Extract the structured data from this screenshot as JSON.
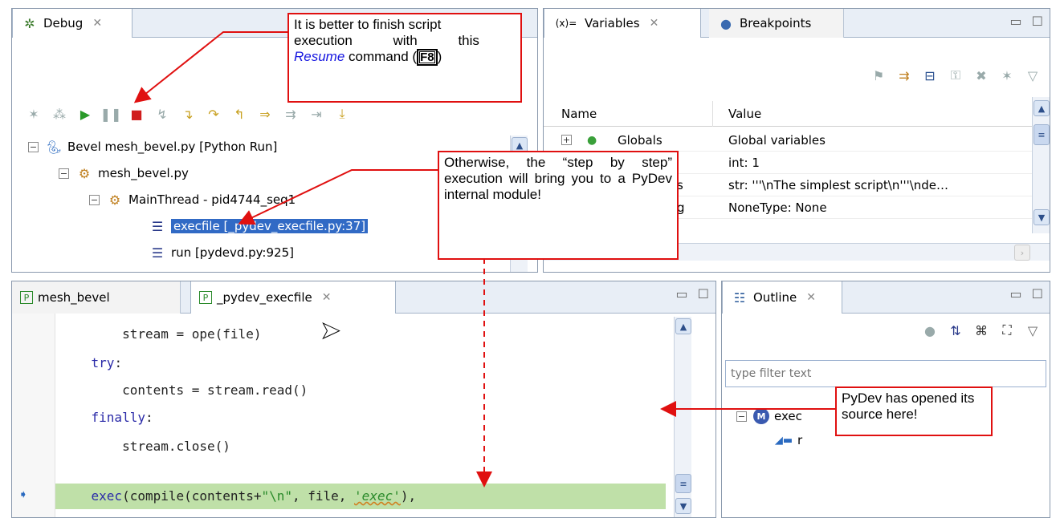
{
  "debug_view": {
    "tab_label": "Debug",
    "tree": [
      {
        "label": "Bevel mesh_bevel.py [Python Run]"
      },
      {
        "label": "mesh_bevel.py"
      },
      {
        "label": "MainThread - pid4744_seq1"
      },
      {
        "label": "execfile [_pydev_execfile.py:37]"
      },
      {
        "label": "run [pydevd.py:925]"
      }
    ]
  },
  "variables_view": {
    "tabs": [
      {
        "label": "Variables"
      },
      {
        "label": "Breakpoints"
      }
    ],
    "columns": [
      "Name",
      "Value"
    ],
    "rows": [
      {
        "name": "Globals",
        "value": "Global variables"
      },
      {
        "name": "",
        "value": "int: 1"
      },
      {
        "name": "s",
        "value": "str: '''\\nThe simplest script\\n'''\\nde…"
      },
      {
        "name": "g",
        "value": "NoneType: None"
      }
    ]
  },
  "editor": {
    "tabs": [
      {
        "label": "mesh_bevel"
      },
      {
        "label": "_pydev_execfile"
      }
    ],
    "lines": [
      {
        "indent": "        ",
        "pre": "stream = ope",
        "kw": "",
        "post": "(file)"
      },
      {
        "indent": "    ",
        "pre": "",
        "kw": "try",
        "post": ":"
      },
      {
        "indent": "        ",
        "pre": "contents = stream.read()",
        "kw": "",
        "post": ""
      },
      {
        "indent": "    ",
        "pre": "",
        "kw": "finally",
        "post": ":"
      },
      {
        "indent": "        ",
        "pre": "stream.close()",
        "kw": "",
        "post": ""
      }
    ],
    "exec_line": {
      "kw": "exec",
      "a": "(compile(contents+",
      "s1": "\"\\n\"",
      "b": ", file, ",
      "s2": "'exec'",
      "c": "),"
    }
  },
  "outline_view": {
    "tab_label": "Outline",
    "filter_placeholder": "type filter text",
    "items": [
      {
        "label": "exec"
      },
      {
        "label": "r"
      }
    ]
  },
  "callouts": {
    "resume": {
      "line1": "It is better to finish script",
      "line2": "execution with this",
      "resume_word": "Resume",
      "command_pre": " command (",
      "key": "F8",
      "command_post": ")"
    },
    "step": "Otherwise, the “step by step” execution will bring you to a PyDev internal module!",
    "source": "PyDev has opened its source here!"
  },
  "colors": {
    "selection": "#316ac5",
    "callout_border": "#e01010",
    "current_line": "#bfe0a8",
    "keyword": "#2a2aa8"
  }
}
